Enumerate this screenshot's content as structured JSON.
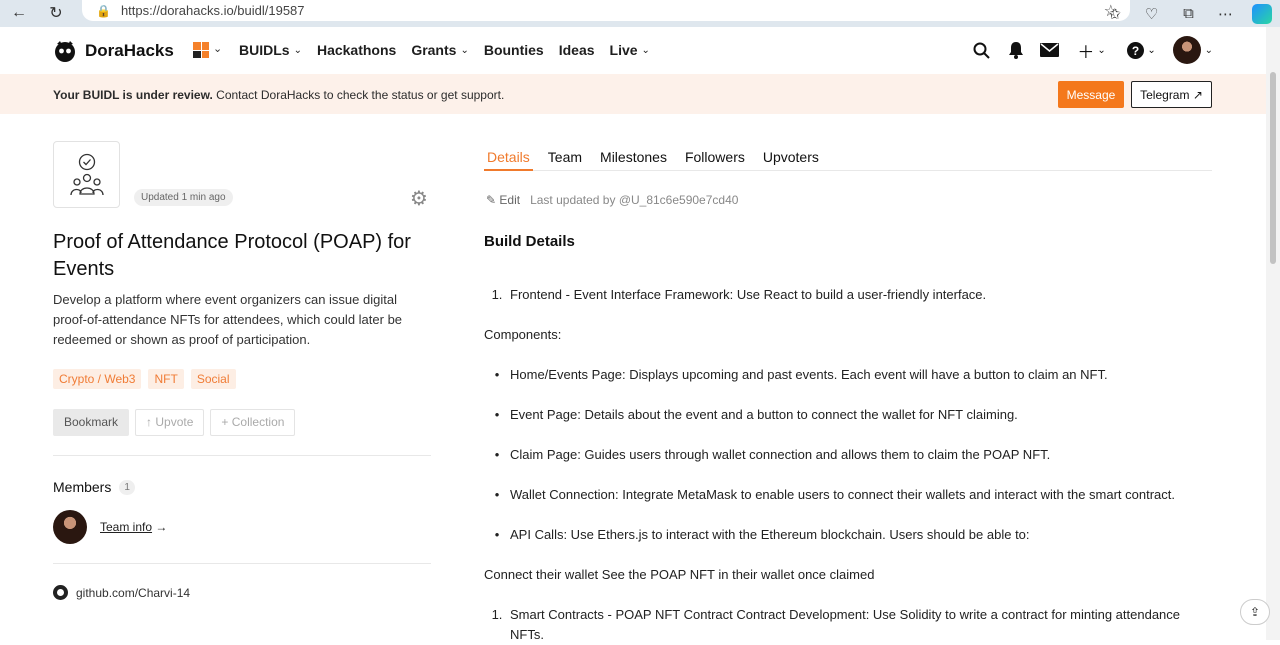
{
  "browser": {
    "url": "https://dorahacks.io/buidl/19587"
  },
  "nav": {
    "brand": "DoraHacks",
    "items": [
      {
        "label": "BUIDLs",
        "caret": "⌄"
      },
      {
        "label": "Hackathons",
        "caret": ""
      },
      {
        "label": "Grants",
        "caret": "⌄"
      },
      {
        "label": "Bounties",
        "caret": ""
      },
      {
        "label": "Ideas",
        "caret": ""
      },
      {
        "label": "Live",
        "caret": "⌄"
      }
    ]
  },
  "banner": {
    "bold": "Your BUIDL is under review.",
    "text": " Contact DoraHacks to check the status or get support.",
    "message_button": "Message",
    "telegram_button": "Telegram ↗"
  },
  "project": {
    "updated": "Updated 1 min ago",
    "title": "Proof of Attendance Protocol (POAP) for Events",
    "description": "Develop a platform where event organizers can issue digital proof-of-attendance NFTs for attendees, which could later be redeemed or shown as proof of participation.",
    "tags": [
      "Crypto / Web3",
      "NFT",
      "Social"
    ],
    "actions": {
      "bookmark": "Bookmark",
      "upvote": "↑ Upvote",
      "collection": "+ Collection"
    },
    "members_label": "Members",
    "members_count": "1",
    "team_info": "Team info",
    "team_arrow": " →",
    "github": "github.com/Charvi-14"
  },
  "tabs": [
    {
      "label": "Details",
      "active": true
    },
    {
      "label": "Team",
      "active": false
    },
    {
      "label": "Milestones",
      "active": false
    },
    {
      "label": "Followers",
      "active": false
    },
    {
      "label": "Upvoters",
      "active": false
    }
  ],
  "edit": {
    "edit_label": "✎ Edit",
    "last_updated": "Last updated by @U_81c6e590e7cd40"
  },
  "details": {
    "heading": "Build Details",
    "lines": [
      {
        "marker": "1.",
        "text": "Frontend - Event Interface Framework: Use React to build a user-friendly interface."
      },
      {
        "marker": "",
        "text": "Components:"
      },
      {
        "marker": "•",
        "text": "Home/Events Page: Displays upcoming and past events. Each event will have a button to claim an NFT."
      },
      {
        "marker": "•",
        "text": "Event Page: Details about the event and a button to connect the wallet for NFT claiming."
      },
      {
        "marker": "•",
        "text": "Claim Page: Guides users through wallet connection and allows them to claim the POAP NFT."
      },
      {
        "marker": "•",
        "text": "Wallet Connection: Integrate MetaMask to enable users to connect their wallets and interact with the smart contract."
      },
      {
        "marker": "•",
        "text": "API Calls: Use Ethers.js to interact with the Ethereum blockchain. Users should be able to:"
      },
      {
        "marker": "",
        "text": "Connect their wallet See the POAP NFT in their wallet once claimed"
      },
      {
        "marker": "1.",
        "text": "Smart Contracts - POAP NFT Contract Contract Development: Use Solidity to write a contract for minting attendance NFTs."
      }
    ]
  }
}
